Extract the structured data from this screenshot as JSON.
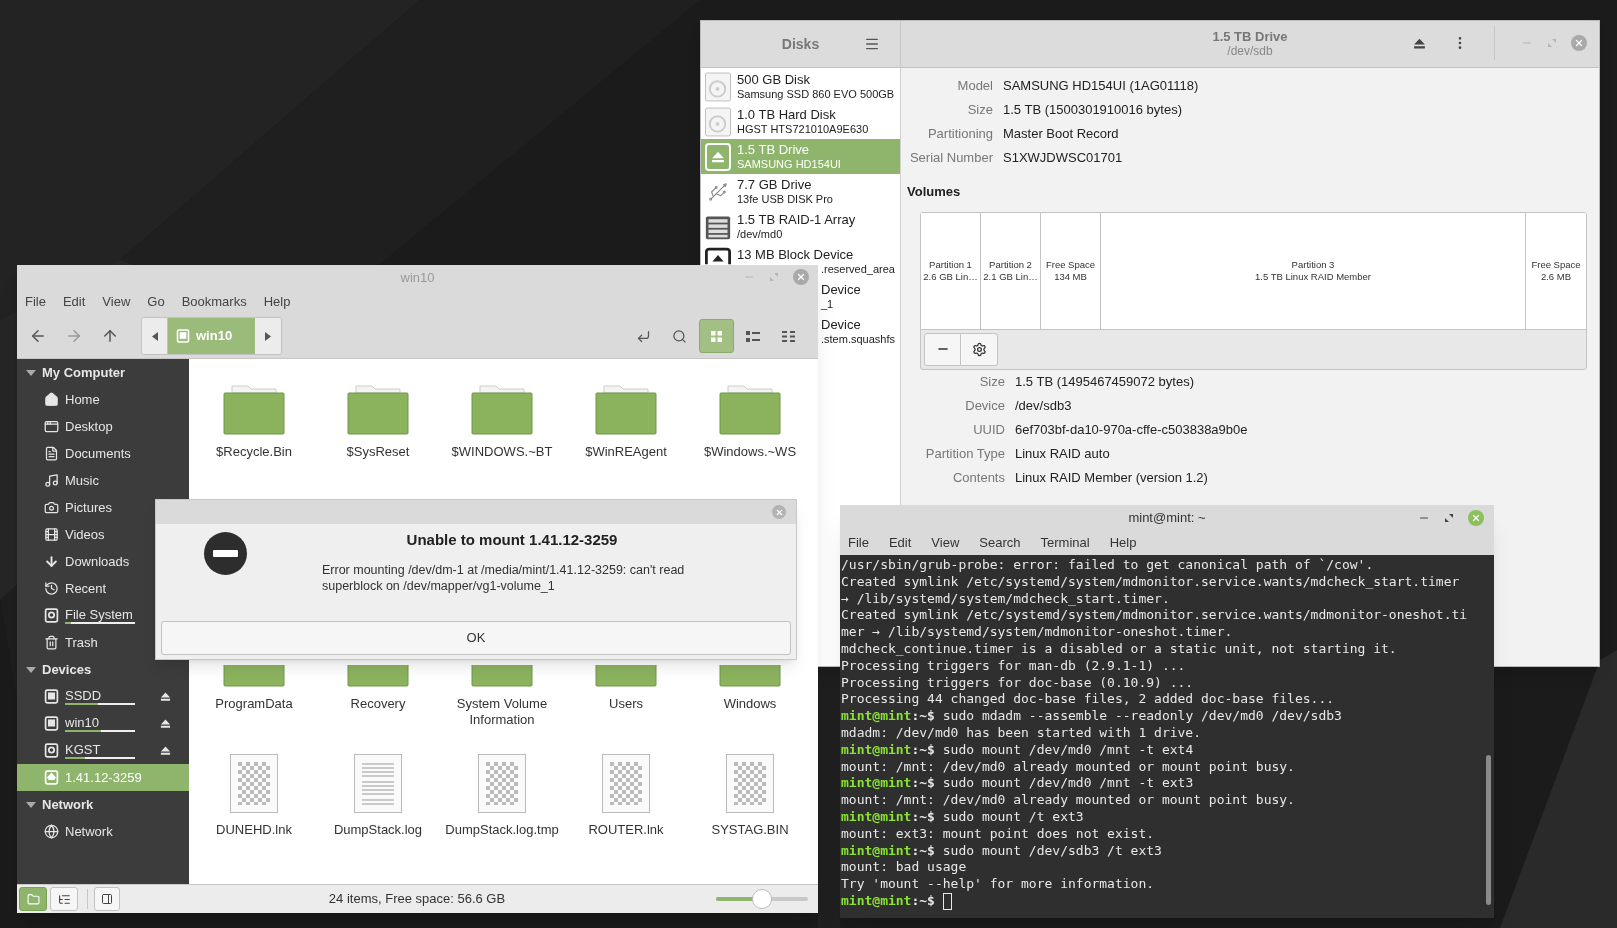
{
  "disks": {
    "sidebar_title": "Disks",
    "drives": [
      {
        "kind": "disk",
        "title": "500 GB Disk",
        "subtitle": "Samsung SSD 860 EVO 500GB",
        "selected": false
      },
      {
        "kind": "disk",
        "title": "1.0 TB Hard Disk",
        "subtitle": "HGST HTS721010A9E630",
        "selected": false
      },
      {
        "kind": "eject",
        "title": "1.5 TB Drive",
        "subtitle": "SAMSUNG HD154UI",
        "selected": true
      },
      {
        "kind": "usb",
        "title": "7.7 GB Drive",
        "subtitle": "13fe USB DISK Pro",
        "selected": false
      },
      {
        "kind": "raid",
        "title": "1.5 TB RAID-1 Array",
        "subtitle": "/dev/md0",
        "selected": false
      },
      {
        "kind": "block",
        "title": "13 MB Block Device",
        "subtitle": ".reserved_area",
        "subtitle_cut": true,
        "selected": false
      },
      {
        "title": "Device",
        "subtitle": "_1",
        "title_cut": true,
        "subtitle_cut": true,
        "selected": false
      },
      {
        "title": "Device",
        "subtitle": ".stem.squashfs",
        "title_cut": true,
        "subtitle_cut": true,
        "selected": false
      }
    ],
    "drive_title": "1.5 TB Drive",
    "drive_path": "/dev/sdb",
    "properties": [
      {
        "label": "Model",
        "value": "SAMSUNG HD154UI (1AG01118)"
      },
      {
        "label": "Size",
        "value": "1.5 TB (1500301910016 bytes)"
      },
      {
        "label": "Partitioning",
        "value": "Master Boot Record"
      },
      {
        "label": "Serial Number",
        "value": "S1XWJDWSC01701"
      }
    ],
    "volumes_heading": "Volumes",
    "partitions": [
      {
        "kind": "small",
        "name": "Partition 1",
        "detail": "2.6 GB Lin…"
      },
      {
        "kind": "small",
        "name": "Partition 2",
        "detail": "2.1 GB Lin…"
      },
      {
        "kind": "small",
        "name": "Free Space",
        "detail": "134 MB"
      },
      {
        "kind": "wide",
        "name": "Partition 3",
        "detail": "1.5 TB Linux RAID Member"
      },
      {
        "kind": "small",
        "name": "Free Space",
        "detail": "2.6 MB"
      }
    ],
    "volume_properties": [
      {
        "label": "Size",
        "value": "1.5 TB (1495467459072 bytes)"
      },
      {
        "label": "Device",
        "value": "/dev/sdb3"
      },
      {
        "label": "UUID",
        "value": "6ef703bf-da10-970a-cffe-c503838a9b0e"
      },
      {
        "label": "Partition Type",
        "value": "Linux RAID auto"
      },
      {
        "label": "Contents",
        "value": "Linux RAID Member (version 1.2)"
      }
    ]
  },
  "files": {
    "title": "win10",
    "menu": [
      "File",
      "Edit",
      "View",
      "Go",
      "Bookmarks",
      "Help"
    ],
    "breadcrumb": "win10",
    "view_buttons": [
      {
        "kind": "icons",
        "selected": true
      },
      {
        "kind": "list",
        "selected": false
      },
      {
        "kind": "compact",
        "selected": false
      }
    ],
    "sidebar": [
      {
        "heading": "My Computer",
        "expanded": true,
        "items": [
          {
            "kind": "home",
            "label": "Home",
            "selected": false
          },
          {
            "kind": "desktop",
            "label": "Desktop",
            "selected": false
          },
          {
            "kind": "document",
            "label": "Documents",
            "selected": false
          },
          {
            "kind": "music",
            "label": "Music",
            "selected": false
          },
          {
            "kind": "camera",
            "label": "Pictures",
            "selected": false
          },
          {
            "kind": "film",
            "label": "Videos",
            "selected": false
          },
          {
            "kind": "download",
            "label": "Downloads",
            "selected": false
          },
          {
            "kind": "history",
            "label": "Recent",
            "selected": false
          },
          {
            "kind": "drive",
            "label": "File System",
            "level": 0.08,
            "selected": false
          },
          {
            "kind": "trash",
            "label": "Trash",
            "selected": false
          }
        ]
      },
      {
        "heading": "Devices",
        "expanded": true,
        "items": [
          {
            "kind": "chip",
            "label": "SSDD",
            "level": 0.47,
            "eject": true,
            "selected": false
          },
          {
            "kind": "chip",
            "label": "win10",
            "level": 0.52,
            "eject": true,
            "selected": false
          },
          {
            "kind": "drive",
            "label": "KGST",
            "level": 0.29,
            "eject": true,
            "selected": false
          },
          {
            "kind": "mounted",
            "label": "1.41.12-3259",
            "selected": true
          }
        ]
      },
      {
        "heading": "Network",
        "expanded": true,
        "items": [
          {
            "kind": "globe",
            "label": "Network",
            "selected": false
          }
        ]
      }
    ],
    "grid_rows": [
      [
        {
          "kind": "folder",
          "label": "$Recycle.Bin"
        },
        {
          "kind": "folder",
          "label": "$SysReset"
        },
        {
          "kind": "folder",
          "label": "$WINDOWS.~BT"
        },
        {
          "kind": "folder",
          "label": "$WinREAgent"
        },
        {
          "kind": "folder",
          "label": "$Windows.~WS"
        }
      ],
      [
        {
          "kind": "folder",
          "label": "ProgramData"
        },
        {
          "kind": "folder",
          "label": "Recovery"
        },
        {
          "kind": "folder",
          "label": "System Volume Information"
        },
        {
          "kind": "folder",
          "label": "Users"
        },
        {
          "kind": "folder",
          "label": "Windows"
        }
      ],
      [
        {
          "kind": "blank",
          "label": "DUNEHD.lnk"
        },
        {
          "kind": "text",
          "label": "DumpStack.log"
        },
        {
          "kind": "blank",
          "label": "DumpStack.log.tmp"
        },
        {
          "kind": "blank",
          "label": "ROUTER.lnk"
        },
        {
          "kind": "blank",
          "label": "SYSTAG.BIN"
        }
      ]
    ],
    "status_buttons": [
      {
        "kind": "places",
        "selected": true
      },
      {
        "kind": "tree",
        "selected": false
      }
    ],
    "status": "24 items, Free space: 56.6 GB",
    "zoom": {
      "level": 0.5
    },
    "dialog": {
      "title": "Unable to mount 1.41.12-3259",
      "message": "Error mounting /dev/dm-1 at /media/mint/1.41.12-3259: can't read superblock on /dev/mapper/vg1-volume_1",
      "button": "OK"
    }
  },
  "terminal": {
    "title": "mint@mint: ~",
    "menu": [
      "File",
      "Edit",
      "View",
      "Search",
      "Terminal",
      "Help"
    ],
    "lines": [
      {
        "kind": "output",
        "text": "/usr/sbin/grub-probe: error: failed to get canonical path of `/cow'."
      },
      {
        "kind": "output",
        "text": "Created symlink /etc/systemd/system/mdmonitor.service.wants/mdcheck_start.timer"
      },
      {
        "kind": "output",
        "text": "→ /lib/systemd/system/mdcheck_start.timer."
      },
      {
        "kind": "output",
        "text": "Created symlink /etc/systemd/system/mdmonitor.service.wants/mdmonitor-oneshot.ti"
      },
      {
        "kind": "output",
        "text": "mer → /lib/systemd/system/mdmonitor-oneshot.timer."
      },
      {
        "kind": "output",
        "text": "mdcheck_continue.timer is a disabled or a static unit, not starting it."
      },
      {
        "kind": "output",
        "text": "Processing triggers for man-db (2.9.1-1) ..."
      },
      {
        "kind": "output",
        "text": "Processing triggers for doc-base (0.10.9) ..."
      },
      {
        "kind": "output",
        "text": "Processing 44 changed doc-base files, 2 added doc-base files..."
      },
      {
        "kind": "prompt",
        "user": "mint@mint",
        "path": ":~$",
        "command": "sudo mdadm --assemble --readonly /dev/md0 /dev/sdb3"
      },
      {
        "kind": "output",
        "text": "mdadm: /dev/md0 has been started with 1 drive."
      },
      {
        "kind": "prompt",
        "user": "mint@mint",
        "path": ":~$",
        "command": "sudo mount /dev/md0 /mnt -t ext4"
      },
      {
        "kind": "output",
        "text": "mount: /mnt: /dev/md0 already mounted or mount point busy."
      },
      {
        "kind": "prompt",
        "user": "mint@mint",
        "path": ":~$",
        "command": "sudo mount /dev/md0 /mnt -t ext3"
      },
      {
        "kind": "output",
        "text": "mount: /mnt: /dev/md0 already mounted or mount point busy."
      },
      {
        "kind": "prompt",
        "user": "mint@mint",
        "path": ":~$",
        "command": "sudo mount /t ext3"
      },
      {
        "kind": "output",
        "text": "mount: ext3: mount point does not exist."
      },
      {
        "kind": "prompt",
        "user": "mint@mint",
        "path": ":~$",
        "command": "sudo mount /dev/sdb3 /t ext3"
      },
      {
        "kind": "output",
        "text": "mount: bad usage"
      },
      {
        "kind": "output",
        "text": "Try 'mount --help' for more information."
      },
      {
        "kind": "prompt",
        "user": "mint@mint",
        "path": ":~$",
        "cursor": true
      }
    ]
  }
}
